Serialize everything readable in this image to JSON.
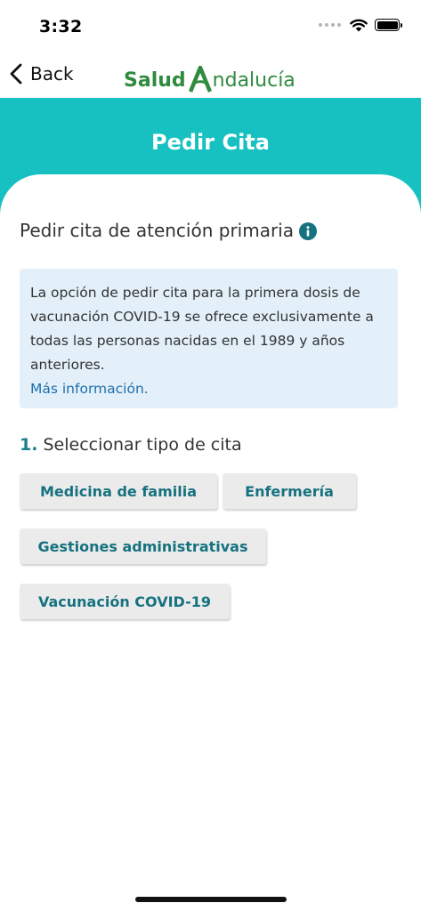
{
  "status_bar": {
    "time": "3:32"
  },
  "nav": {
    "back_label": "Back",
    "logo_salud": "Salud",
    "logo_rest": "ndalucía"
  },
  "header": {
    "title": "Pedir Cita"
  },
  "section": {
    "title": "Pedir cita de atención primaria"
  },
  "notice": {
    "text": "La opción de pedir cita para la primera dosis de vacunación COVID-19 se ofrece exclusivamente a todas las personas nacidas en el 1989 y años anteriores.",
    "link": "Más información."
  },
  "step": {
    "number": "1.",
    "label": "Seleccionar tipo de cita"
  },
  "options": {
    "medicina": "Medicina de familia",
    "enfermeria": "Enfermería",
    "gestiones": "Gestiones administrativas",
    "vacunacion": "Vacunación COVID-19"
  },
  "colors": {
    "header": "#17c1c1",
    "logo_green": "#2f8b3f",
    "button_text": "#16727f",
    "link": "#1f6fae",
    "notice_bg": "#e3f0f9"
  },
  "icons": {
    "back": "chevron-left-icon",
    "info": "info-icon",
    "wifi": "wifi-icon",
    "battery": "battery-icon"
  }
}
